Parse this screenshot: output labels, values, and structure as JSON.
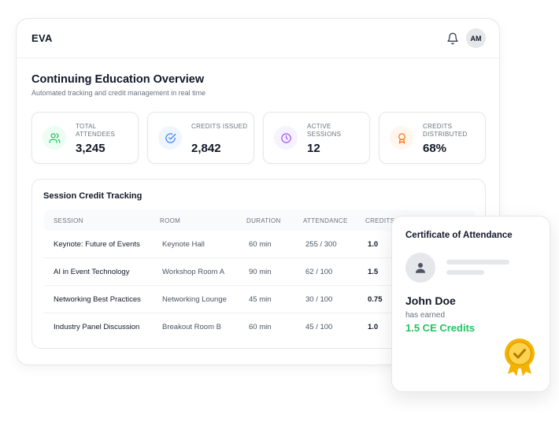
{
  "app": {
    "brand": "EVA",
    "user_initials": "AM"
  },
  "header": {
    "title": "Continuing Education Overview",
    "subtitle": "Automated tracking and credit management in real time"
  },
  "stats": [
    {
      "label": "TOTAL ATTENDEES",
      "value": "3,245",
      "icon": "users-icon",
      "color": "#22c55e",
      "bg": "#ecfdf3"
    },
    {
      "label": "CREDITS ISSUED",
      "value": "2,842",
      "icon": "check-circle-icon",
      "color": "#3b82f6",
      "bg": "#eff6ff"
    },
    {
      "label": "ACTIVE SESSIONS",
      "value": "12",
      "icon": "clock-icon",
      "color": "#a855f7",
      "bg": "#f5f3ff"
    },
    {
      "label": "CREDITS DISTRIBUTED",
      "value": "68%",
      "icon": "award-icon",
      "color": "#f97316",
      "bg": "#fff7ed"
    }
  ],
  "tracking": {
    "title": "Session Credit Tracking",
    "columns": [
      "SESSION",
      "ROOM",
      "DURATION",
      "ATTENDANCE",
      "CREDITS"
    ],
    "rows": [
      {
        "session": "Keynote: Future of Events",
        "room": "Keynote Hall",
        "duration": "60 min",
        "attendance": "255 / 300",
        "credits": "1.0"
      },
      {
        "session": "AI in Event Technology",
        "room": "Workshop Room A",
        "duration": "90 min",
        "attendance": "62 / 100",
        "credits": "1.5"
      },
      {
        "session": "Networking Best Practices",
        "room": "Networking Lounge",
        "duration": "45 min",
        "attendance": "30 / 100",
        "credits": "0.75"
      },
      {
        "session": "Industry Panel Discussion",
        "room": "Breakout Room B",
        "duration": "60 min",
        "attendance": "45 / 100",
        "credits": "1.0"
      }
    ]
  },
  "certificate": {
    "title": "Certificate of Attendance",
    "name": "John Doe",
    "earned_label": "has earned",
    "credits": "1.5 CE Credits",
    "accent_color": "#22c55e",
    "badge_color": "#f5b301"
  }
}
